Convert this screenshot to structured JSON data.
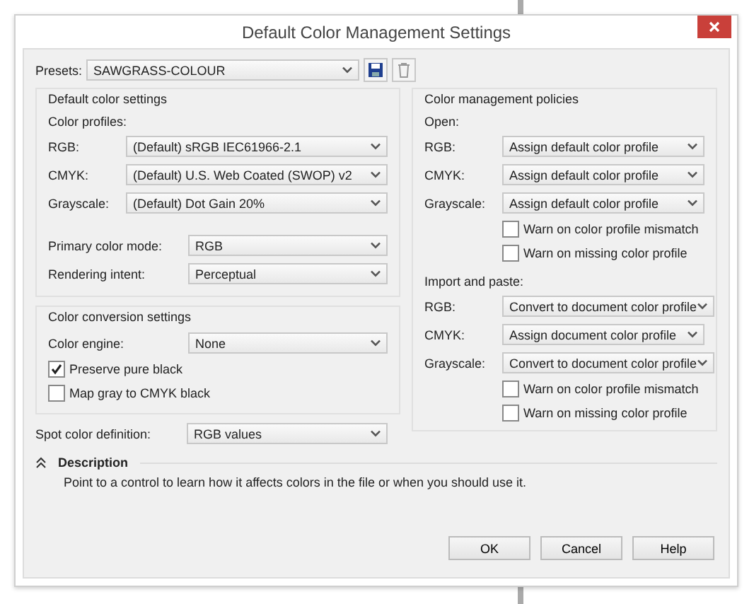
{
  "window": {
    "title": "Default Color Management Settings"
  },
  "presets": {
    "label": "Presets:",
    "value": "SAWGRASS-COLOUR"
  },
  "default_settings": {
    "title": "Default color settings",
    "profiles_label": "Color profiles:",
    "profiles": [
      {
        "label": "RGB:",
        "value": "(Default) sRGB IEC61966-2.1"
      },
      {
        "label": "CMYK:",
        "value": "(Default) U.S. Web Coated (SWOP) v2"
      },
      {
        "label": "Grayscale:",
        "value": "(Default) Dot Gain 20%"
      }
    ],
    "modes": [
      {
        "label": "Primary color mode:",
        "value": "RGB"
      },
      {
        "label": "Rendering intent:",
        "value": "Perceptual"
      }
    ]
  },
  "conversion": {
    "title": "Color conversion settings",
    "engine": {
      "label": "Color engine:",
      "value": "None"
    },
    "checkboxes": [
      {
        "label": "Preserve pure black",
        "checked": true
      },
      {
        "label": "Map gray to CMYK black",
        "checked": false
      }
    ]
  },
  "spot": {
    "label": "Spot color definition:",
    "value": "RGB values"
  },
  "policies": {
    "title": "Color management policies",
    "sections": [
      {
        "title": "Open:",
        "rows": [
          {
            "label": "RGB:",
            "value": "Assign default color profile"
          },
          {
            "label": "CMYK:",
            "value": "Assign default color profile"
          },
          {
            "label": "Grayscale:",
            "value": "Assign default color profile"
          }
        ],
        "checkboxes": [
          {
            "label": "Warn on color profile mismatch",
            "checked": false
          },
          {
            "label": "Warn on missing color profile",
            "checked": false
          }
        ]
      },
      {
        "title": "Import and paste:",
        "rows": [
          {
            "label": "RGB:",
            "value": "Convert to document color profile"
          },
          {
            "label": "CMYK:",
            "value": "Assign document color profile"
          },
          {
            "label": "Grayscale:",
            "value": "Convert to document color profile"
          }
        ],
        "checkboxes": [
          {
            "label": "Warn on color profile mismatch",
            "checked": false
          },
          {
            "label": "Warn on missing color profile",
            "checked": false
          }
        ]
      }
    ]
  },
  "description": {
    "title": "Description",
    "expanded": true,
    "text": "Point to a control to learn how it affects colors in the file or when you should use it."
  },
  "buttons": [
    "OK",
    "Cancel",
    "Help"
  ]
}
